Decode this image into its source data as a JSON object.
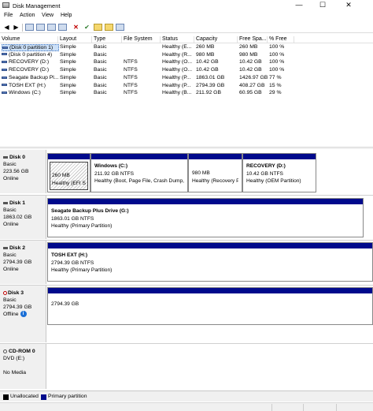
{
  "window": {
    "title": "Disk Management",
    "minimize": "—",
    "maximize": "☐",
    "close": "✕"
  },
  "menu": [
    "File",
    "Action",
    "View",
    "Help"
  ],
  "volume_list": {
    "headers": [
      "Volume",
      "Layout",
      "Type",
      "File System",
      "Status",
      "Capacity",
      "Free Spa...",
      "% Free"
    ],
    "rows": [
      [
        "(Disk 0 partition 1)",
        "Simple",
        "Basic",
        "",
        "Healthy (E...",
        "260 MB",
        "260 MB",
        "100 %"
      ],
      [
        "(Disk 0 partition 4)",
        "Simple",
        "Basic",
        "",
        "Healthy (R...",
        "980 MB",
        "980 MB",
        "100 %"
      ],
      [
        "RECOVERY (D:)",
        "Simple",
        "Basic",
        "NTFS",
        "Healthy (O...",
        "10.42 GB",
        "10.42 GB",
        "100 %"
      ],
      [
        "RECOVERY (D:)",
        "Simple",
        "Basic",
        "NTFS",
        "Healthy (O...",
        "10.42 GB",
        "10.42 GB",
        "100 %"
      ],
      [
        "Seagate Backup Pl...",
        "Simple",
        "Basic",
        "NTFS",
        "Healthy (P...",
        "1863.01 GB",
        "1426.97 GB",
        "77 %"
      ],
      [
        "TOSH EXT (H:)",
        "Simple",
        "Basic",
        "NTFS",
        "Healthy (P...",
        "2794.39 GB",
        "408.27 GB",
        "15 %"
      ],
      [
        "Windows (C:)",
        "Simple",
        "Basic",
        "NTFS",
        "Healthy (B...",
        "211.92 GB",
        "60.95 GB",
        "29 %"
      ]
    ]
  },
  "disks": [
    {
      "name": "Disk 0",
      "type": "Basic",
      "size": "223.56 GB",
      "status": "Online",
      "partitions": [
        {
          "title": "",
          "size": "260 MB",
          "status": "Healthy (EFI Sys"
        },
        {
          "title": "Windows  (C:)",
          "size": "211.92 GB NTFS",
          "status": "Healthy (Boot, Page File, Crash Dump,"
        },
        {
          "title": "",
          "size": "980 MB",
          "status": "Healthy (Recovery P"
        },
        {
          "title": "RECOVERY  (D:)",
          "size": "10.42 GB NTFS",
          "status": "Healthy (OEM Partition)"
        }
      ]
    },
    {
      "name": "Disk 1",
      "type": "Basic",
      "size": "1863.02 GB",
      "status": "Online",
      "partitions": [
        {
          "title": "Seagate Backup Plus Drive  (G:)",
          "size": "1863.01 GB NTFS",
          "status": "Healthy (Primary Partition)"
        }
      ]
    },
    {
      "name": "Disk 2",
      "type": "Basic",
      "size": "2794.39 GB",
      "status": "Online",
      "partitions": [
        {
          "title": "TOSH EXT  (H:)",
          "size": "2794.39 GB NTFS",
          "status": "Healthy (Primary Partition)"
        }
      ]
    },
    {
      "name": "Disk 3",
      "type": "Basic",
      "size": "2794.39 GB",
      "status": "Offline",
      "partitions": [
        {
          "title": "",
          "size": "2794.39 GB",
          "status": ""
        }
      ]
    },
    {
      "name": "CD-ROM 0",
      "type": "DVD (E:)",
      "size": "",
      "status": "No Media",
      "partitions": []
    }
  ],
  "legend": [
    "Unallocated",
    "Primary partition"
  ],
  "colors": {
    "primary": "#000a8c",
    "unallocated": "#000000",
    "selection": "#cce0f7"
  }
}
